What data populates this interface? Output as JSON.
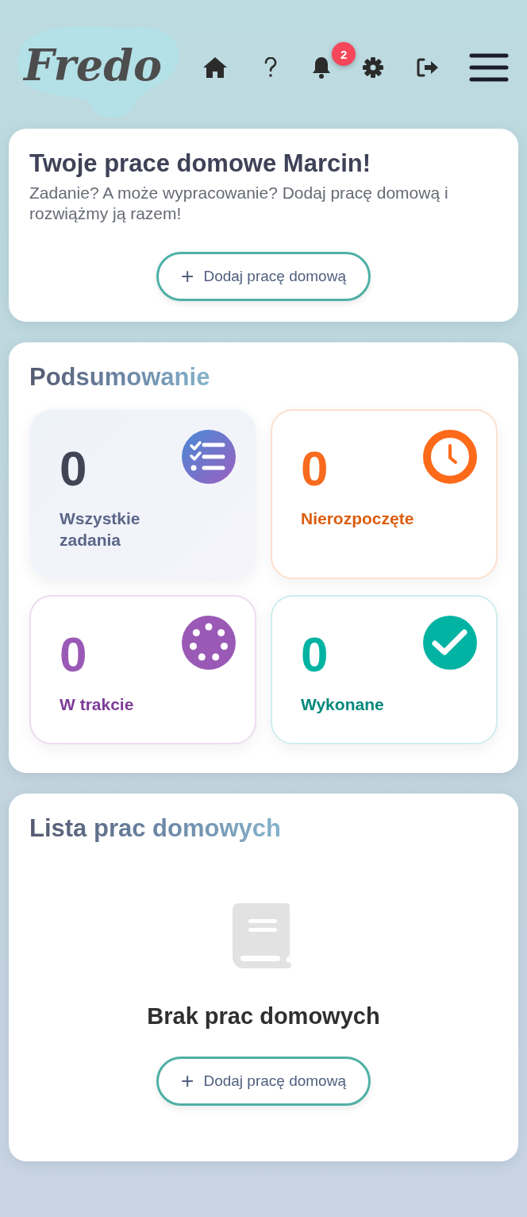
{
  "header": {
    "logo": "Fredo",
    "notifications_badge": "2"
  },
  "intro": {
    "title": "Twoje prace domowe Marcin!",
    "text": "Zadanie? A może wypracowanie? Dodaj pracę domową i rozwiążmy ją razem!",
    "button": {
      "icon": "+",
      "label": "Dodaj pracę domową"
    }
  },
  "summary": {
    "title": "Podsumowanie",
    "stats": [
      {
        "kind": "all",
        "value": "0",
        "label": "Wszystkie zadania"
      },
      {
        "kind": "todo",
        "value": "0",
        "label": "Nierozpoczęte"
      },
      {
        "kind": "progress",
        "value": "0",
        "label": "W trakcie"
      },
      {
        "kind": "done",
        "value": "0",
        "label": "Wykonane"
      }
    ]
  },
  "list": {
    "title": "Lista prac domowych",
    "empty_text": "Brak prac domowych",
    "button": {
      "icon": "+",
      "label": "Dodaj pracę domową"
    }
  }
}
